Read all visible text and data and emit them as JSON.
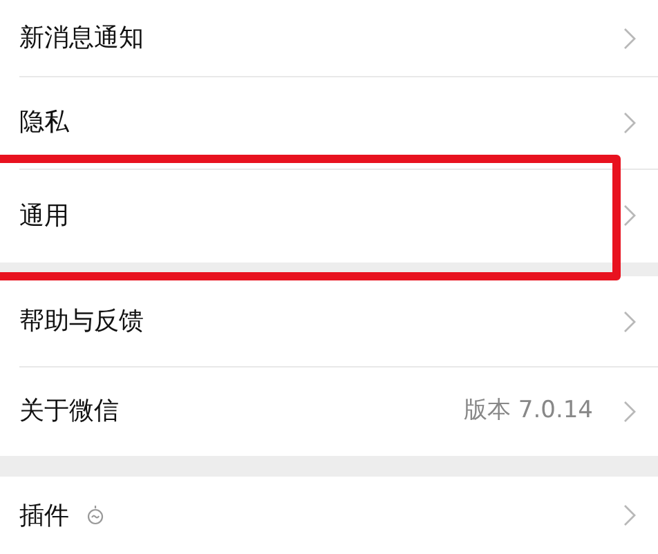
{
  "groups": [
    {
      "items": [
        {
          "label": "新消息通知",
          "highlighted": false
        },
        {
          "label": "隐私",
          "highlighted": false
        },
        {
          "label": "通用",
          "highlighted": true
        }
      ]
    },
    {
      "items": [
        {
          "label": "帮助与反馈",
          "highlighted": false
        },
        {
          "label": "关于微信",
          "value": "版本 7.0.14",
          "highlighted": false
        }
      ]
    },
    {
      "items": [
        {
          "label": "插件",
          "kind": "with-icon",
          "highlighted": false
        }
      ]
    }
  ]
}
